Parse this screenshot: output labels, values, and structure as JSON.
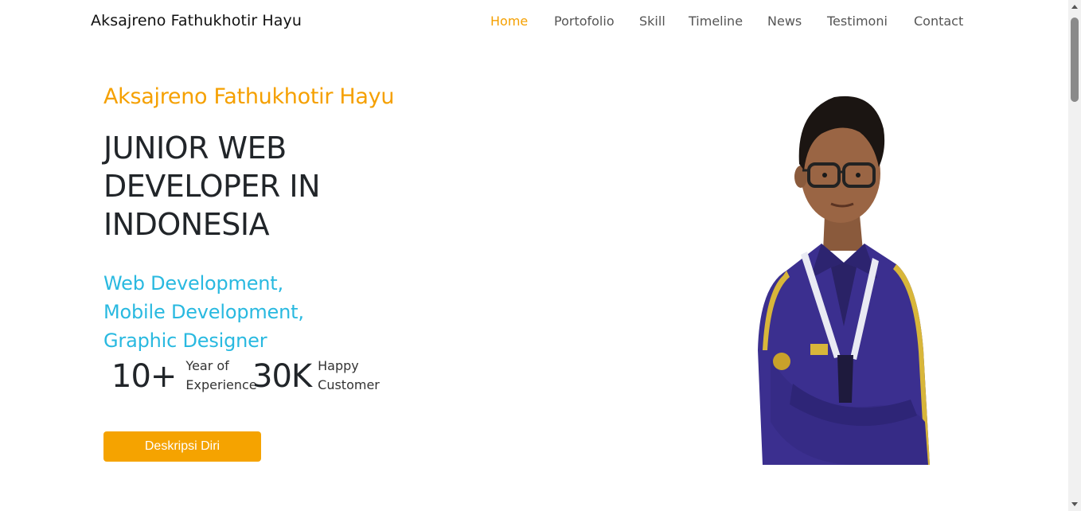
{
  "navbar": {
    "brand": "Aksajreno Fathukhotir Hayu",
    "items": [
      {
        "label": "Home"
      },
      {
        "label": "Portofolio"
      },
      {
        "label": "Skill"
      },
      {
        "label": "Timeline"
      },
      {
        "label": "News"
      },
      {
        "label": "Testimoni"
      },
      {
        "label": "Contact"
      }
    ],
    "active_color": "#f5a000"
  },
  "hero": {
    "name": "Aksajreno Fathukhotir Hayu",
    "title": "JUNIOR WEB DEVELOPER IN INDONESIA",
    "roles": [
      "Web Development,",
      "Mobile Development,",
      "Graphic Designer"
    ],
    "stats": [
      {
        "value": "10+",
        "label_line1": "Year of",
        "label_line2": "Experience"
      },
      {
        "value": "30K",
        "label_line1": "Happy",
        "label_line2": "Customer"
      }
    ],
    "button_label": "Deskripsi Diri",
    "accent_color": "#f5a000",
    "role_color": "#29b9e0"
  },
  "portrait": {
    "icon": "person-portrait-image"
  }
}
